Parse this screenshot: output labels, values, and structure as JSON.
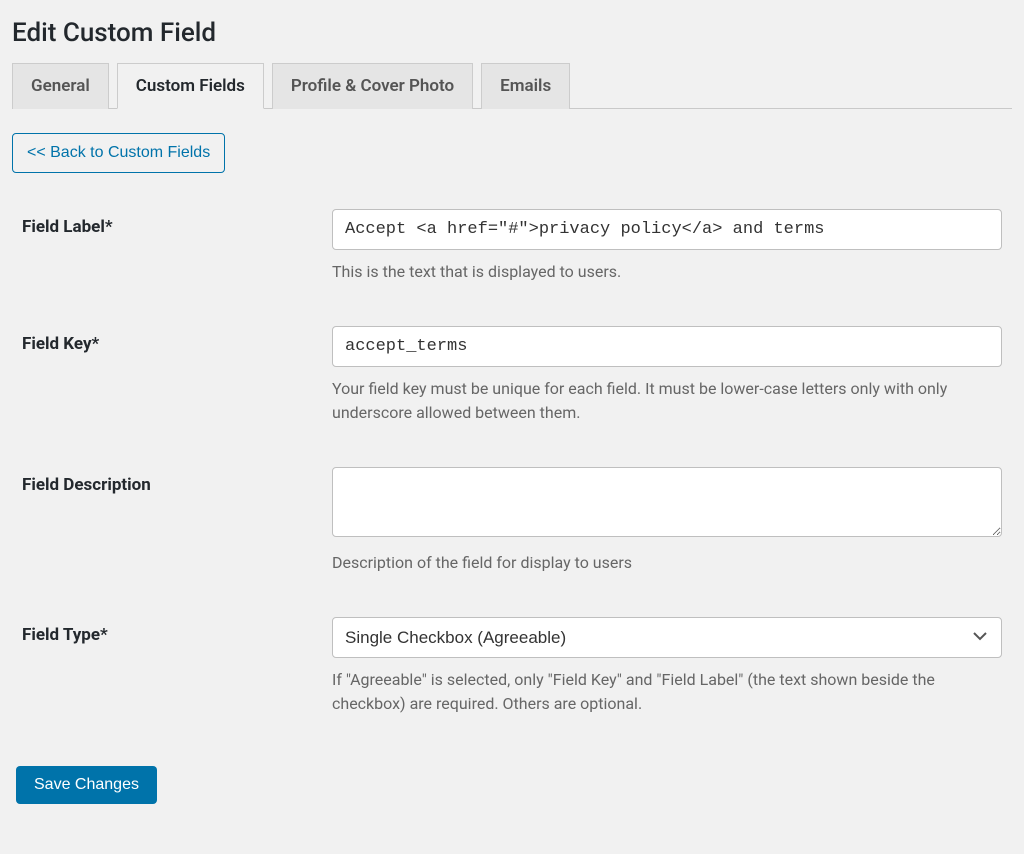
{
  "page": {
    "title": "Edit Custom Field"
  },
  "tabs": {
    "general": "General",
    "custom_fields": "Custom Fields",
    "profile_cover": "Profile & Cover Photo",
    "emails": "Emails"
  },
  "back_button": "<< Back to Custom Fields",
  "fields": {
    "field_label": {
      "label": "Field Label*",
      "value": "Accept <a href=\"#\">privacy policy</a> and terms",
      "help": "This is the text that is displayed to users."
    },
    "field_key": {
      "label": "Field Key*",
      "value": "accept_terms",
      "help": "Your field key must be unique for each field. It must be lower-case letters only with only underscore allowed between them."
    },
    "field_description": {
      "label": "Field Description",
      "value": "",
      "help": "Description of the field for display to users"
    },
    "field_type": {
      "label": "Field Type*",
      "value": "Single Checkbox (Agreeable)",
      "help": "If \"Agreeable\" is selected, only \"Field Key\" and \"Field Label\" (the text shown beside the checkbox) are required. Others are optional."
    }
  },
  "actions": {
    "save": "Save Changes"
  }
}
